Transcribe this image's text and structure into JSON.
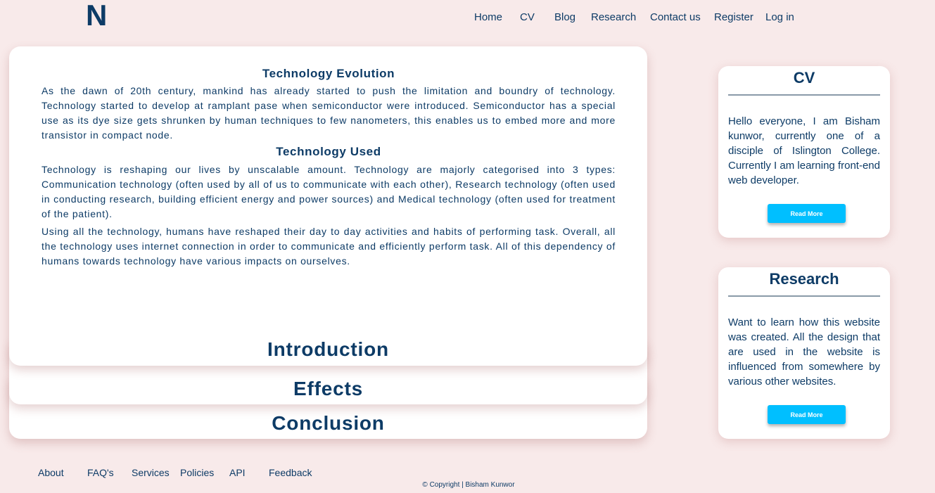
{
  "header": {
    "logo": "N",
    "nav": [
      {
        "label": "Home"
      },
      {
        "label": "CV"
      },
      {
        "label": "Blog"
      },
      {
        "label": "Research"
      },
      {
        "label": "Contact us"
      },
      {
        "label": "Register"
      },
      {
        "label": "Log in"
      }
    ]
  },
  "main": {
    "intro_card": {
      "sections": [
        {
          "heading": "Technology Evolution",
          "paragraphs": [
            "As the dawn of 20th century, mankind has already started to push the limitation and boundry of technology. Technology started to develop at ramplant pase when semiconductor were introduced. Semiconductor has a special use as its dye size gets shrunken by human techniques to few nanometers, this enables us to embed more and more transistor in compact node."
          ]
        },
        {
          "heading": "Technology Used",
          "paragraphs": [
            "Technology is reshaping our lives by unscalable amount. Technology are majorly categorised into 3 types: Communication technology (often used by all of us to communicate with each other), Research technology (often used in conducting research, building efficient energy and power sources) and Medical technology (often used for treatment of the patient).",
            "Using all the technology, humans have reshaped their day to day activities and habits of performing task. Overall, all the technology uses internet connection in order to communicate and efficiently perform task. All of this dependency of humans towards technology have various impacts on ourselves."
          ]
        }
      ],
      "title": "Introduction"
    },
    "effects_card": {
      "title": "Effects"
    },
    "conclusion_card": {
      "title": "Conclusion"
    }
  },
  "sidebar": {
    "cv": {
      "title": "CV",
      "text": "Hello everyone, I am Bisham kunwor, currently one of a disciple of Islington College. Currently I am learning front-end web developer.",
      "button": "Read More"
    },
    "research": {
      "title": "Research",
      "text": "Want to learn how this website was created. All the design that are used in the website is influenced from somewhere by various other websites.",
      "button": "Read More"
    }
  },
  "footer": {
    "links": [
      {
        "label": "About"
      },
      {
        "label": "FAQ's"
      },
      {
        "label": "Services"
      },
      {
        "label": "Policies"
      },
      {
        "label": "API"
      },
      {
        "label": "Feedback"
      }
    ],
    "copyright": "© Copyright | Bisham Kunwor"
  },
  "colors": {
    "background": "#f8eaea",
    "text": "#0d3b66",
    "button": "#00bfff"
  }
}
